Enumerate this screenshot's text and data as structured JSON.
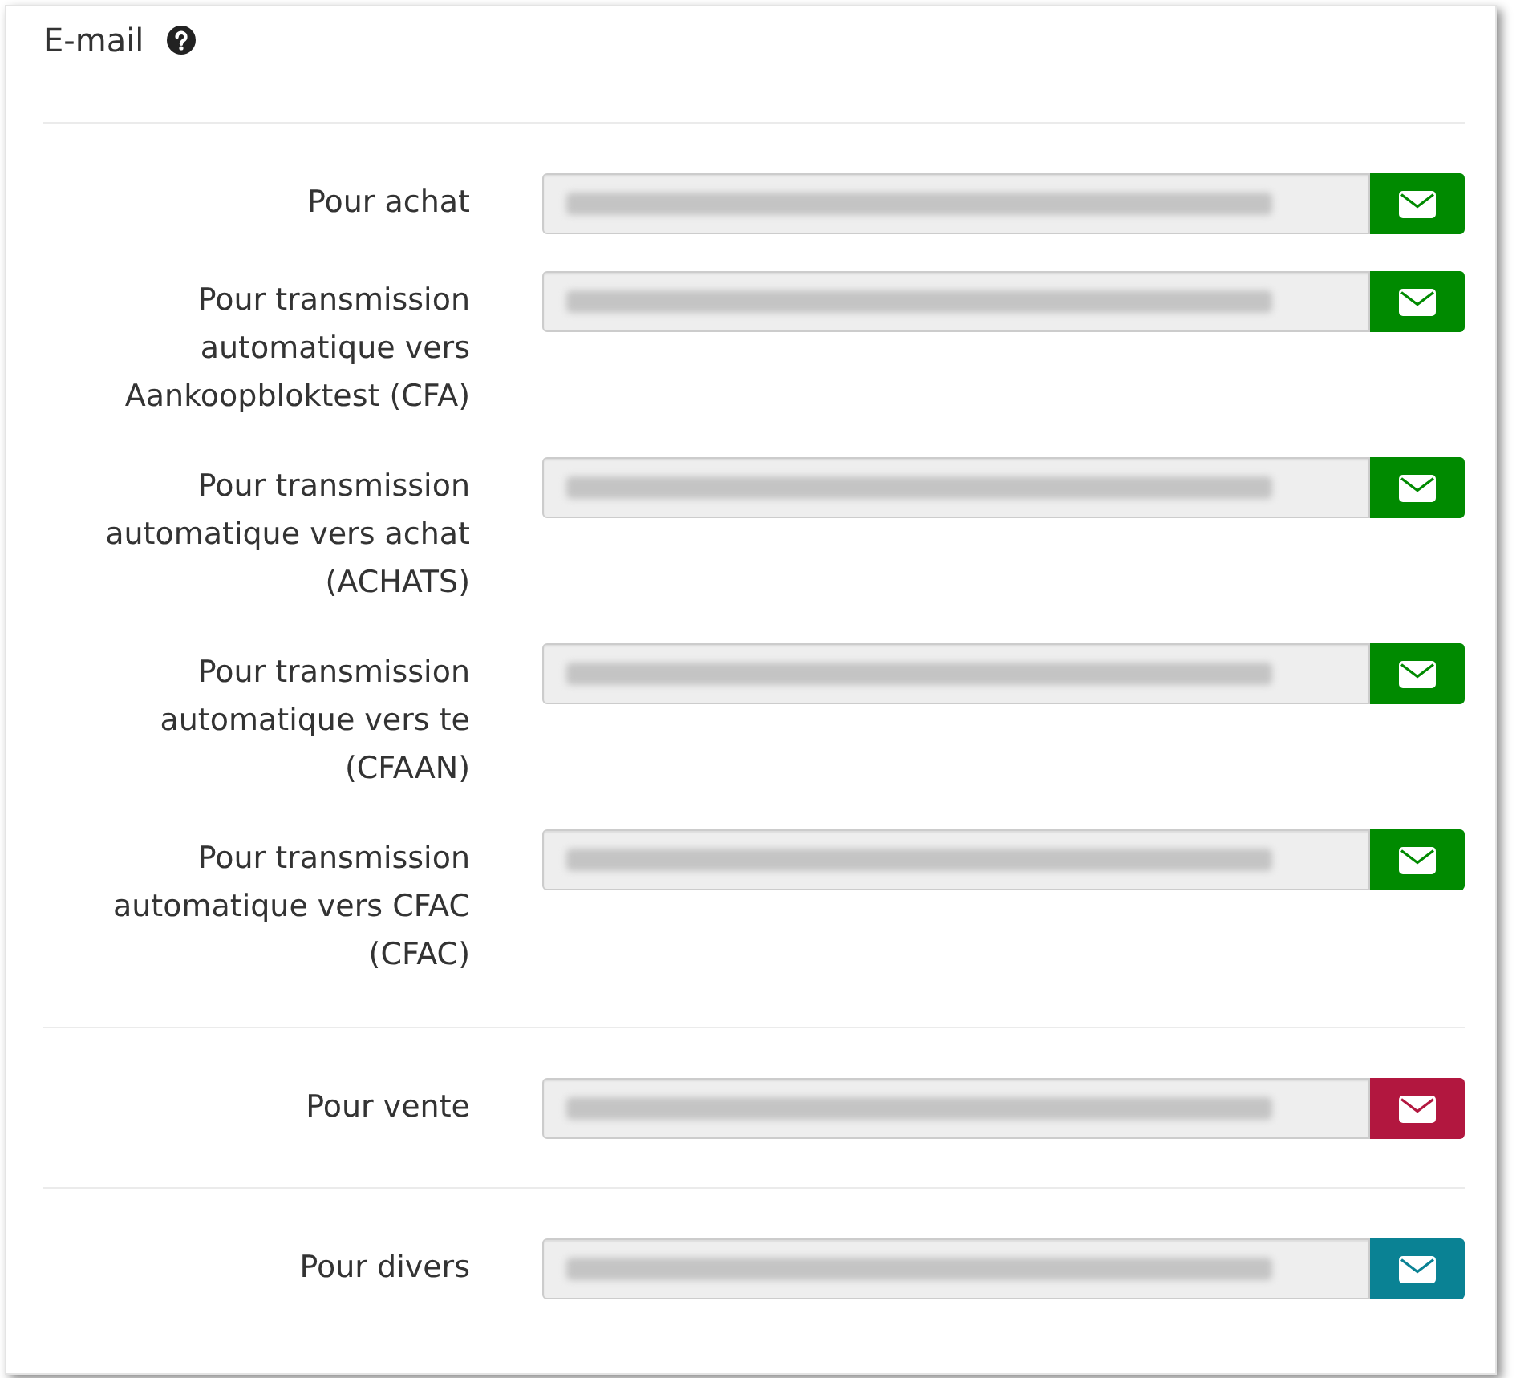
{
  "heading": {
    "title": "E-mail"
  },
  "sections": [
    {
      "rows": [
        {
          "label": "Pour achat",
          "color": "#008a00"
        },
        {
          "label": "Pour transmission automatique vers Aankoopbloktest (CFA)",
          "color": "#008a00"
        },
        {
          "label": "Pour transmission automatique vers achat (ACHATS)",
          "color": "#008a00"
        },
        {
          "label": "Pour transmission automatique vers te (CFAAN)",
          "color": "#008a00"
        },
        {
          "label": "Pour transmission automatique vers CFAC (CFAC)",
          "color": "#008a00"
        }
      ]
    },
    {
      "rows": [
        {
          "label": "Pour vente",
          "color": "#b2173f"
        }
      ]
    },
    {
      "rows": [
        {
          "label": "Pour divers",
          "color": "#0a8294"
        }
      ]
    }
  ]
}
